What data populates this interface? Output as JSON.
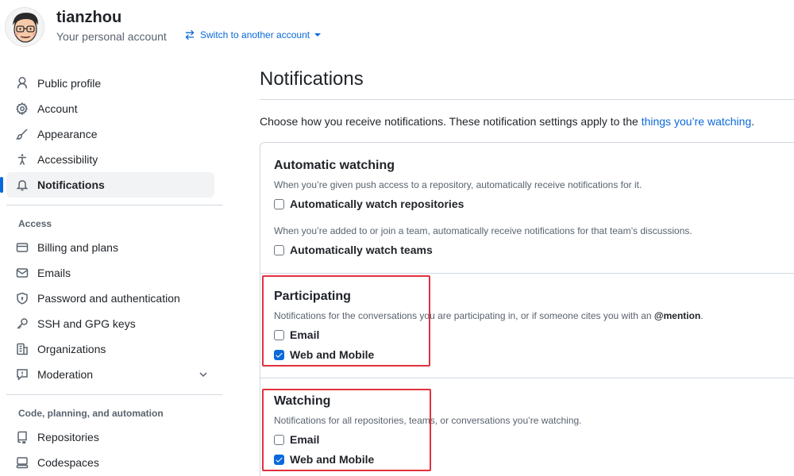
{
  "header": {
    "username": "tianzhou",
    "subtitle": "Your personal account",
    "switch_label": "Switch to another account"
  },
  "sidebar": {
    "items": [
      {
        "label": "Public profile",
        "icon": "person-icon"
      },
      {
        "label": "Account",
        "icon": "gear-icon"
      },
      {
        "label": "Appearance",
        "icon": "paintbrush-icon"
      },
      {
        "label": "Accessibility",
        "icon": "accessibility-icon"
      },
      {
        "label": "Notifications",
        "icon": "bell-icon",
        "active": true
      }
    ],
    "access_heading": "Access",
    "access_items": [
      {
        "label": "Billing and plans",
        "icon": "credit-card-icon"
      },
      {
        "label": "Emails",
        "icon": "mail-icon"
      },
      {
        "label": "Password and authentication",
        "icon": "shield-lock-icon"
      },
      {
        "label": "SSH and GPG keys",
        "icon": "key-icon"
      },
      {
        "label": "Organizations",
        "icon": "organization-icon"
      },
      {
        "label": "Moderation",
        "icon": "report-icon",
        "expandable": true
      }
    ],
    "code_heading": "Code, planning, and automation",
    "code_items": [
      {
        "label": "Repositories",
        "icon": "repo-icon"
      },
      {
        "label": "Codespaces",
        "icon": "codespaces-icon"
      }
    ]
  },
  "main": {
    "title": "Notifications",
    "intro_text": "Choose how you receive notifications. These notification settings apply to the ",
    "intro_link": "things you’re watching",
    "intro_end": ".",
    "automatic": {
      "title": "Automatic watching",
      "desc_repos": "When you’re given push access to a repository, automatically receive notifications for it.",
      "repos_label": "Automatically watch repositories",
      "repos_checked": false,
      "desc_teams": "When you’re added to or join a team, automatically receive notifications for that team’s discussions.",
      "teams_label": "Automatically watch teams",
      "teams_checked": false
    },
    "participating": {
      "title": "Participating",
      "desc": "Notifications for the conversations you are participating in, or if someone cites you with an ",
      "desc_mention": "@mention",
      "desc_end": ".",
      "email_label": "Email",
      "email_checked": false,
      "web_label": "Web and Mobile",
      "web_checked": true
    },
    "watching": {
      "title": "Watching",
      "desc": "Notifications for all repositories, teams, or conversations you’re watching.",
      "email_label": "Email",
      "email_checked": false,
      "web_label": "Web and Mobile",
      "web_checked": true
    }
  },
  "colors": {
    "accent": "#0969da",
    "highlight": "#e0313f",
    "text": "#1f2328",
    "muted": "#59636e",
    "border": "#d1d9e0"
  }
}
